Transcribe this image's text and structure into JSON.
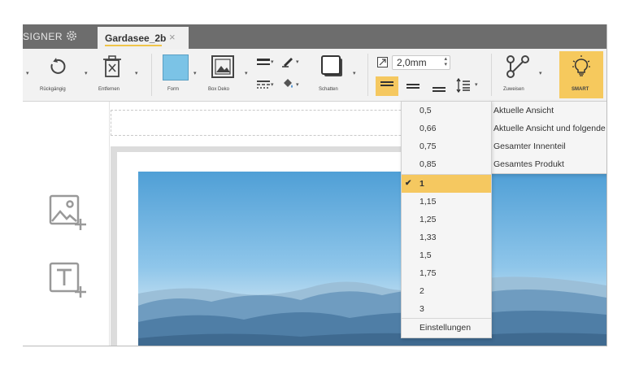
{
  "tabbar": {
    "app_label": "SIGNER",
    "tab_title": "Gardasee_2b",
    "tab_close": "×"
  },
  "toolbar": {
    "undo_label": "Rückgängig",
    "remove_label": "Entfernen",
    "shape_label": "Form",
    "box_deco_label": "Box Deko",
    "shadow_label": "Schatten",
    "assign_label": "Zuweisen",
    "smart_label": "SMART",
    "stroke_width_value": "2,0mm",
    "shape_color": "#7bc3e6",
    "accent_color": "#f5c860"
  },
  "line_spacing_menu": {
    "items": [
      "0,5",
      "0,66",
      "0,75",
      "0,85",
      "1",
      "1,15",
      "1,25",
      "1,33",
      "1,5",
      "1,75",
      "2",
      "3"
    ],
    "selected": "1",
    "check": "✔",
    "footer": "Einstellungen"
  },
  "view_menu": {
    "items": [
      "Aktuelle Ansicht",
      "Aktuelle Ansicht und folgende",
      "Gesamter Innenteil",
      "Gesamtes Produkt"
    ]
  },
  "side_tools": {
    "add_image": "add-image",
    "add_text": "add-text"
  }
}
